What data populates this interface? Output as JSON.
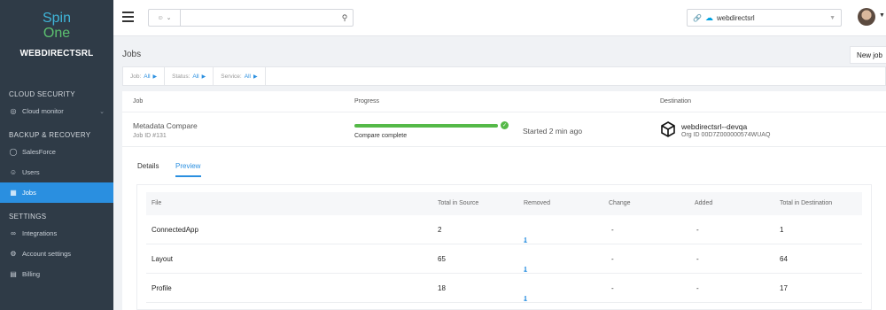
{
  "sidebar": {
    "logo_top": "Spin",
    "logo_bottom": "One",
    "org": "WEBDIRECTSRL",
    "sections": [
      {
        "title": "CLOUD SECURITY"
      },
      {
        "title": "BACKUP & RECOVERY"
      },
      {
        "title": "SETTINGS"
      }
    ],
    "items": [
      {
        "label": "Cloud monitor",
        "icon": "globe-icon"
      },
      {
        "label": "SalesForce",
        "icon": "shield-icon"
      },
      {
        "label": "Users",
        "icon": "user-icon"
      },
      {
        "label": "Jobs",
        "icon": "jobs-icon"
      },
      {
        "label": "Integrations",
        "icon": "link-icon"
      },
      {
        "label": "Account settings",
        "icon": "gear-icon"
      },
      {
        "label": "Billing",
        "icon": "card-icon"
      }
    ]
  },
  "topbar": {
    "search_value": "",
    "tenant": "webdirectsrl"
  },
  "page": {
    "title": "Jobs",
    "new_job": "New job"
  },
  "filters": [
    {
      "label": "Job:",
      "value": "All"
    },
    {
      "label": "Status:",
      "value": "All"
    },
    {
      "label": "Service:",
      "value": "All"
    }
  ],
  "job": {
    "headers": {
      "job": "Job",
      "progress": "Progress",
      "destination": "Destination"
    },
    "name": "Metadata Compare",
    "id": "Job ID #131",
    "progress_percent": 100,
    "progress_label": "Compare complete",
    "started": "Started 2 min ago",
    "dest_name": "webdirectsrl--devqa",
    "dest_org": "Org ID 00D7Z000000574WUAQ"
  },
  "tabs": [
    {
      "label": "Details",
      "active": false
    },
    {
      "label": "Preview",
      "active": true
    }
  ],
  "table": {
    "columns": [
      "File",
      "Total in Source",
      "Removed",
      "Change",
      "Added",
      "Total in Destination"
    ],
    "rows": [
      {
        "file": "ConnectedApp",
        "source": "2",
        "removed": "1",
        "change": "-",
        "added": "-",
        "destination": "1"
      },
      {
        "file": "Layout",
        "source": "65",
        "removed": "1",
        "change": "-",
        "added": "-",
        "destination": "64"
      },
      {
        "file": "Profile",
        "source": "18",
        "removed": "1",
        "change": "-",
        "added": "-",
        "destination": "17"
      }
    ]
  },
  "colors": {
    "accent": "#2a8fe0",
    "sidebar": "#2f3b47",
    "success": "#55b948"
  }
}
